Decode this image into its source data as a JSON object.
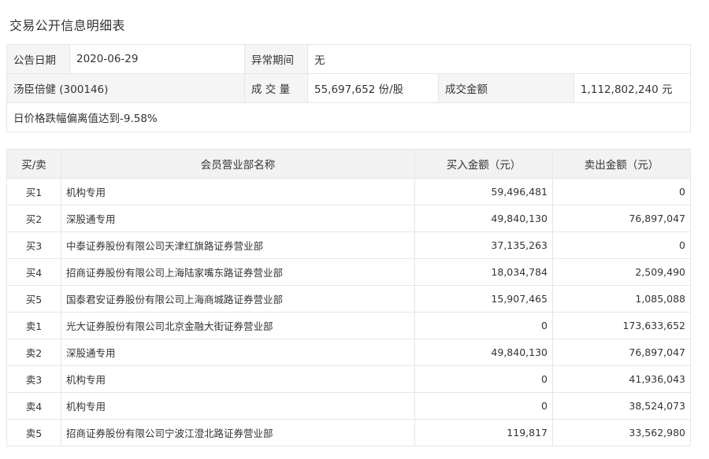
{
  "page": {
    "title": "交易公开信息明细表"
  },
  "info": {
    "date_label": "公告日期",
    "date_value": "2020-06-29",
    "period_label": "异常期间",
    "period_value": "无",
    "stock_name": "汤臣倍健 (300146)",
    "volume_label": "成 交 量",
    "volume_value": "55,697,652 份/股",
    "amount_label": "成交金额",
    "amount_value": "1,112,802,240 元",
    "reason": "日价格跌幅偏离值达到-9.58%"
  },
  "table": {
    "headers": [
      "买/卖",
      "会员营业部名称",
      "买入金额（元）",
      "卖出金额（元）"
    ],
    "rows": [
      {
        "side": "买1",
        "name": "机构专用",
        "buy": "59,496,481",
        "sell": "0"
      },
      {
        "side": "买2",
        "name": "深股通专用",
        "buy": "49,840,130",
        "sell": "76,897,047"
      },
      {
        "side": "买3",
        "name": "中泰证券股份有限公司天津红旗路证券营业部",
        "buy": "37,135,263",
        "sell": "0"
      },
      {
        "side": "买4",
        "name": "招商证券股份有限公司上海陆家嘴东路证券营业部",
        "buy": "18,034,784",
        "sell": "2,509,490"
      },
      {
        "side": "买5",
        "name": "国泰君安证券股份有限公司上海商城路证券营业部",
        "buy": "15,907,465",
        "sell": "1,085,088"
      },
      {
        "side": "卖1",
        "name": "光大证券股份有限公司北京金融大街证券营业部",
        "buy": "0",
        "sell": "173,633,652"
      },
      {
        "side": "卖2",
        "name": "深股通专用",
        "buy": "49,840,130",
        "sell": "76,897,047"
      },
      {
        "side": "卖3",
        "name": "机构专用",
        "buy": "0",
        "sell": "41,936,043"
      },
      {
        "side": "卖4",
        "name": "机构专用",
        "buy": "0",
        "sell": "38,524,073"
      },
      {
        "side": "卖5",
        "name": "招商证券股份有限公司宁波江澄北路证券营业部",
        "buy": "119,817",
        "sell": "33,562,980"
      }
    ]
  }
}
